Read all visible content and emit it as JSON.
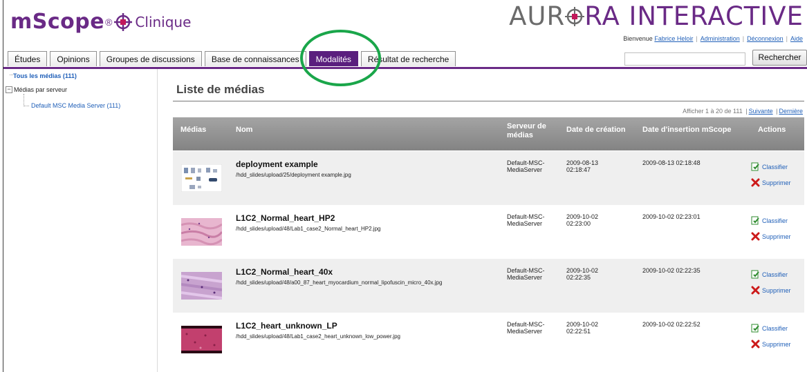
{
  "header": {
    "logo_main": "mScope",
    "logo_reg": "®",
    "logo_sub": "Clinique",
    "brand_left": "AUR",
    "brand_right": "RA INTERACTIVE",
    "welcome": "Bienvenue",
    "user_name": "Fabrice Heloir",
    "admin_label": "Administration",
    "logout_label": "Déconnexion",
    "help_label": "Aide"
  },
  "tabs": [
    {
      "label": "Études",
      "active": false
    },
    {
      "label": "Opinions",
      "active": false
    },
    {
      "label": "Groupes de discussions",
      "active": false
    },
    {
      "label": "Base de connaissances",
      "active": false
    },
    {
      "label": "Modalités",
      "active": true
    },
    {
      "label": "Résultat de recherche",
      "active": false
    }
  ],
  "search": {
    "value": "",
    "button_label": "Rechercher"
  },
  "sidebar": {
    "root_label": "Tous les médias (111)",
    "node_label": "Médias par serveur",
    "leaf_label": "Default MSC Media Server (111)"
  },
  "main": {
    "title": "Liste de médias",
    "pager_text": "Afficher 1 à 20 de 111",
    "next_label": "Suivante",
    "last_label": "Dernière",
    "columns": {
      "media": "Médias",
      "name": "Nom",
      "server": "Serveur de médias",
      "created": "Date de création",
      "inserted": "Date d'insertion mScope",
      "actions": "Actions"
    },
    "rows": [
      {
        "name": "deployment example",
        "path": "/hdd_slides/upload/25/deployment example.jpg",
        "server_1": "Default-MSC-",
        "server_2": "MediaServer",
        "created_date": "2009-08-13",
        "created_time": "02:18:47",
        "inserted": "2009-08-13 02:18:48",
        "classify": "Classifier",
        "delete": "Supprimer"
      },
      {
        "name": "L1C2_Normal_heart_HP2",
        "path": "/hdd_slides/upload/48/Lab1_case2_Normal_heart_HP2.jpg",
        "server_1": "Default-MSC-",
        "server_2": "MediaServer",
        "created_date": "2009-10-02",
        "created_time": "02:23:00",
        "inserted": "2009-10-02 02:23:01",
        "classify": "Classifier",
        "delete": "Supprimer"
      },
      {
        "name": "L1C2_Normal_heart_40x",
        "path": "/hdd_slides/upload/48/a00_87_heart_myocardium_normal_lipofuscin_micro_40x.jpg",
        "server_1": "Default-MSC-",
        "server_2": "MediaServer",
        "created_date": "2009-10-02",
        "created_time": "02:22:35",
        "inserted": "2009-10-02 02:22:35",
        "classify": "Classifier",
        "delete": "Supprimer"
      },
      {
        "name": "L1C2_heart_unknown_LP",
        "path": "/hdd_slides/upload/48/Lab1_case2_heart_unknown_low_power.jpg",
        "server_1": "Default-MSC-",
        "server_2": "MediaServer",
        "created_date": "2009-10-02",
        "created_time": "02:22:51",
        "inserted": "2009-10-02 02:22:52",
        "classify": "Classifier",
        "delete": "Supprimer"
      }
    ]
  },
  "colors": {
    "brand_purple": "#6a2a86",
    "active_tab": "#5a1f7e",
    "link_blue": "#1f5fb8",
    "highlight_ellipse": "#1aa64a",
    "classify_icon": "#2e8b2e",
    "delete_icon": "#cc1a1a"
  },
  "icons": {
    "classify": "document-check-icon",
    "delete": "red-x-icon",
    "logo_mark": "crosshair-logo-icon",
    "brand_mark": "crosshair-o-icon"
  }
}
